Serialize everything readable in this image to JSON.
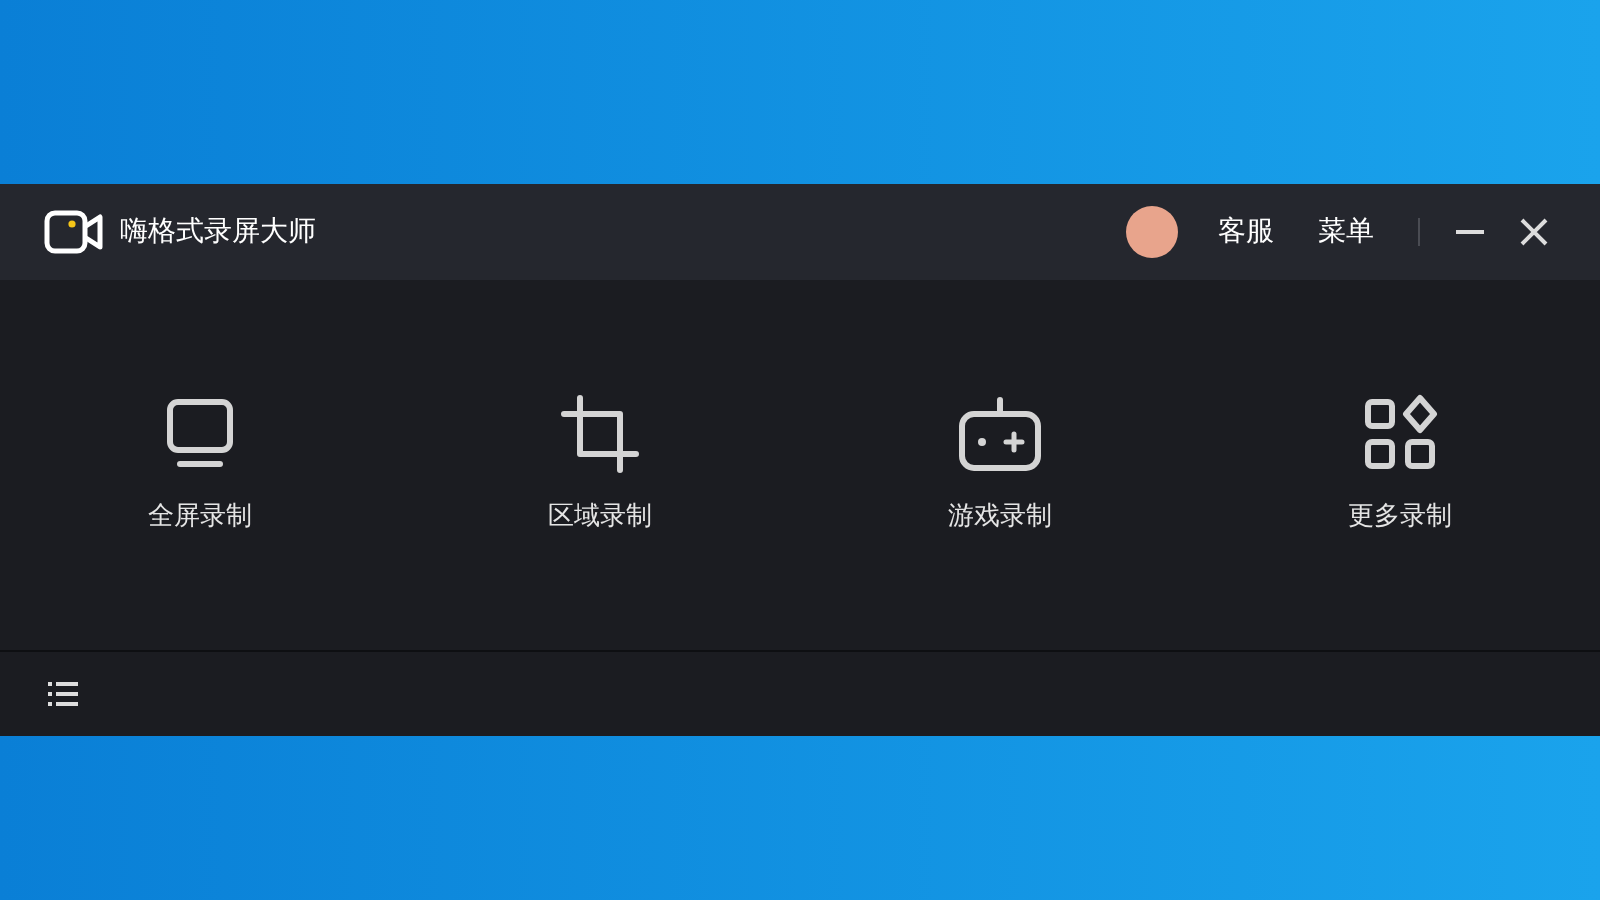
{
  "window": {
    "title": "嗨格式录屏大师",
    "header_links": [
      "客服",
      "菜单"
    ]
  },
  "modes": [
    {
      "kind": "fullscreen",
      "label": "全屏录制"
    },
    {
      "kind": "region",
      "label": "区域录制"
    },
    {
      "kind": "game",
      "label": "游戏录制"
    },
    {
      "kind": "more",
      "label": "更多录制"
    }
  ]
}
